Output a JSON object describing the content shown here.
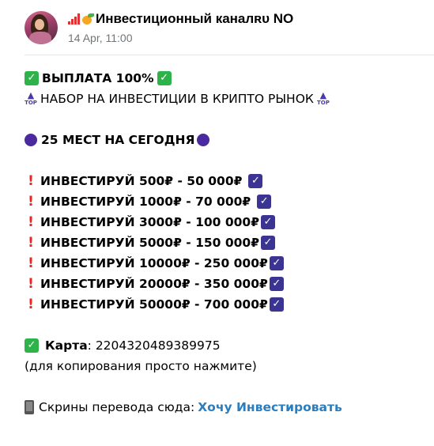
{
  "header": {
    "channel_name": "Инвестиционный каналʀᴜ NO",
    "date": "14 Apr, 11:00",
    "icons": [
      "chart-icon",
      "mango-icon"
    ]
  },
  "message": {
    "payout": "ВЫПЛАТА 100%",
    "recruit": "НАБОР НА ИНВЕСТИЦИИ В КРИПТО РЫНОК",
    "top_icon_text": "TOP",
    "places": "25 МЕСТ НА СЕГОДНЯ",
    "offers": [
      "ИНВЕСТИРУЙ 500₽ - 50 000₽",
      "ИНВЕСТИРУЙ 1000₽ - 70 000₽",
      "ИНВЕСТИРУЙ 3000₽ - 100 000₽",
      "ИНВЕСТИРУЙ 5000₽ - 150 000₽",
      "ИНВЕСТИРУЙ 10000₽ - 250 000₽",
      "ИНВЕСТИРУЙ 20000₽ - 350 000₽",
      "ИНВЕСТИРУЙ 50000₽ - 700 000₽"
    ],
    "card_label": "Карта",
    "card_number": ": 2204320489389975",
    "copy_hint": "(для копирования просто нажмите)",
    "screens_text": "Скрины перевода сюда: ",
    "link_text": "Хочу Инвестировать"
  },
  "colors": {
    "link": "#2a7dbf",
    "check_green": "#2eb24a",
    "check_purple": "#3b3492",
    "dot_purple": "#4a2a9e",
    "exclamation": "#e22222",
    "date": "#707579"
  }
}
